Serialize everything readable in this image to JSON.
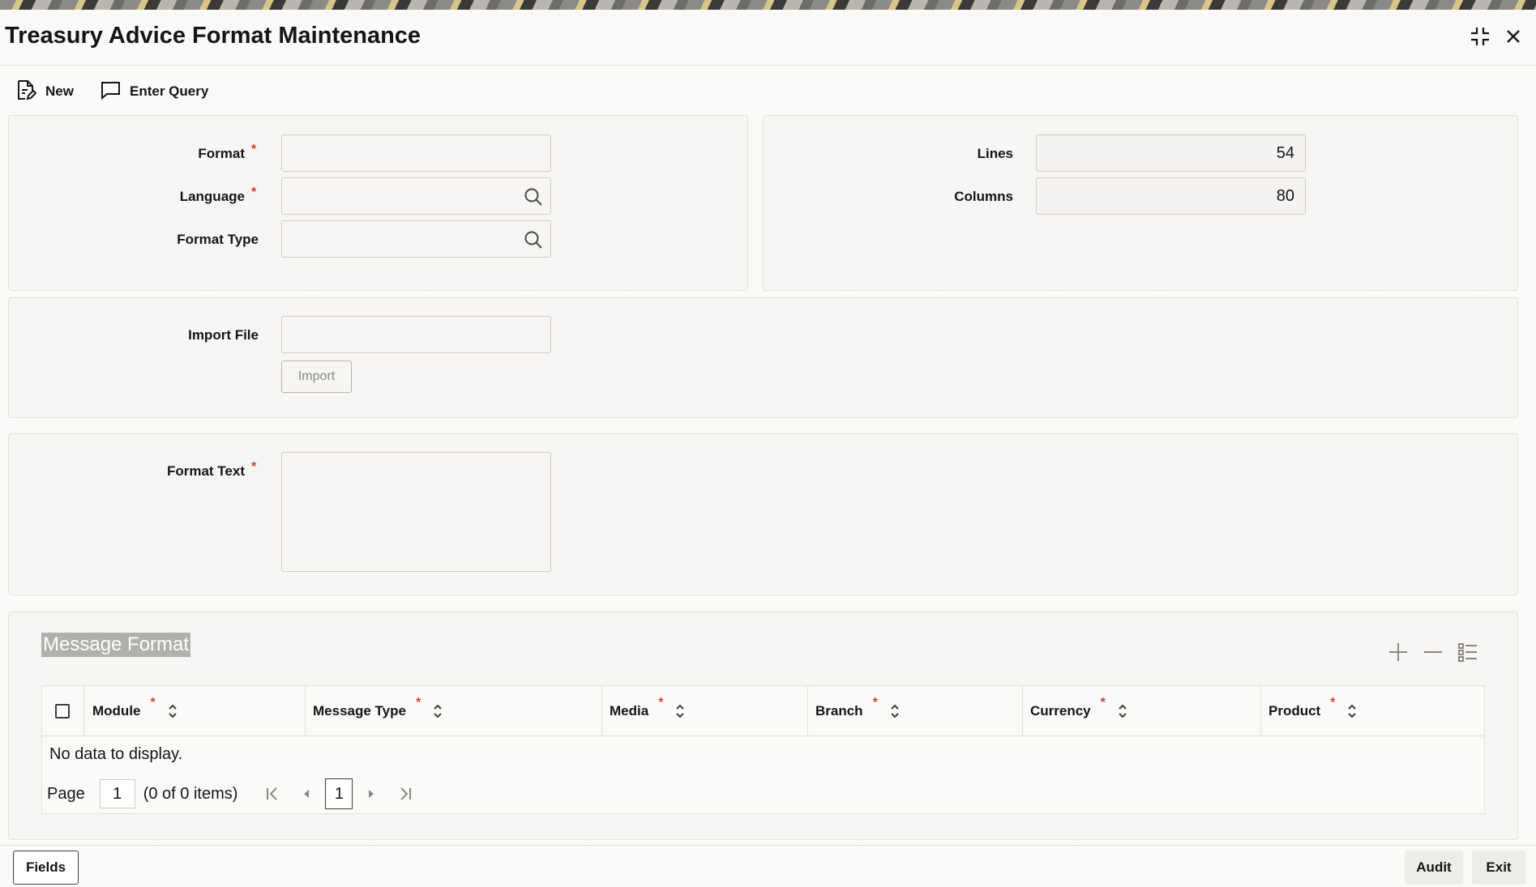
{
  "window": {
    "title": "Treasury Advice Format Maintenance"
  },
  "toolbar": {
    "new_label": "New",
    "enter_query_label": "Enter Query"
  },
  "form": {
    "format_label": "Format",
    "language_label": "Language",
    "format_type_label": "Format Type",
    "lines_label": "Lines",
    "lines_value": "54",
    "columns_label": "Columns",
    "columns_value": "80",
    "import_file_label": "Import File",
    "import_button": "Import",
    "format_text_label": "Format Text",
    "required_marker": "*"
  },
  "message_format": {
    "section_title": "Message Format",
    "columns": [
      "Module",
      "Message Type",
      "Media",
      "Branch",
      "Currency",
      "Product"
    ],
    "empty_text": "No data to display.",
    "pager": {
      "page_label": "Page",
      "page_value": "1",
      "items_text": "(0 of 0 items)",
      "current_page": "1"
    }
  },
  "footer": {
    "fields_button": "Fields",
    "audit_button": "Audit",
    "exit_button": "Exit"
  },
  "colors": {
    "required": "#c74634",
    "panel_bg": "#f7f6f4",
    "text": "#161513"
  }
}
